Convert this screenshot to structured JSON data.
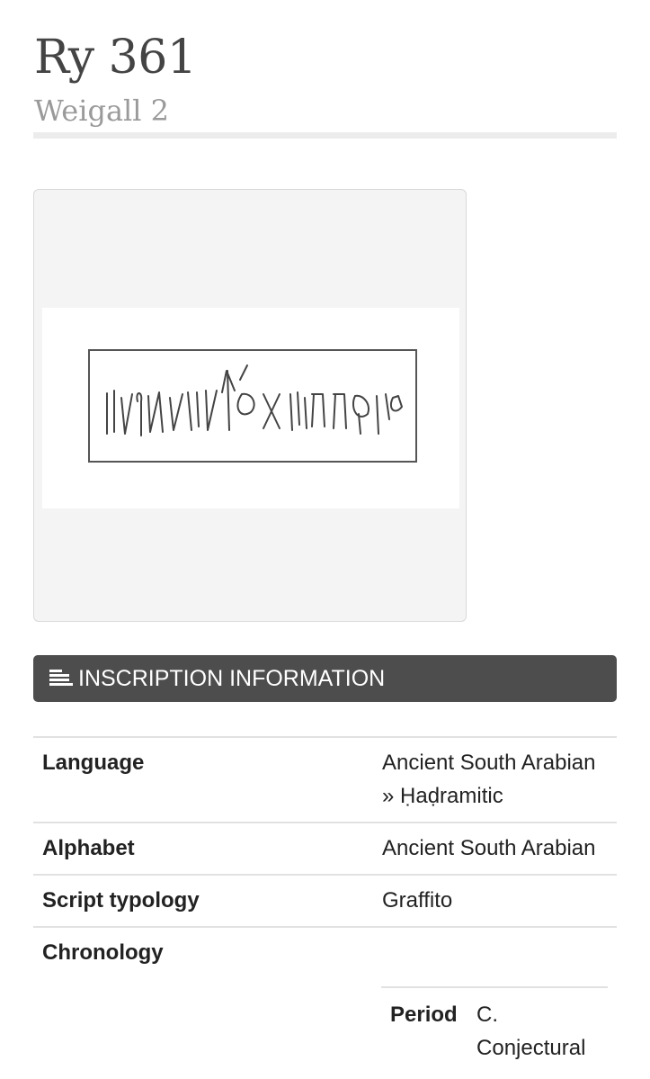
{
  "header": {
    "title": "Ry 361",
    "subtitle": "Weigall 2"
  },
  "image": {
    "icon": "inscription-drawing"
  },
  "section": {
    "icon": "list-icon",
    "title": "INSCRIPTION INFORMATION"
  },
  "info": {
    "rows": [
      {
        "key": "Language",
        "value": "Ancient South Arabian » Ḥaḍramitic"
      },
      {
        "key": "Alphabet",
        "value": "Ancient South Arabian"
      },
      {
        "key": "Script typology",
        "value": "Graffito"
      },
      {
        "key": "Chronology",
        "value": ""
      }
    ],
    "chronology": {
      "period_label": "Period",
      "period_value": "C. Conjectural"
    }
  },
  "colors": {
    "header_bg": "#4d4d4d",
    "title": "#444444",
    "subtitle": "#9a9a9a",
    "divider": "#e1e1e1"
  }
}
